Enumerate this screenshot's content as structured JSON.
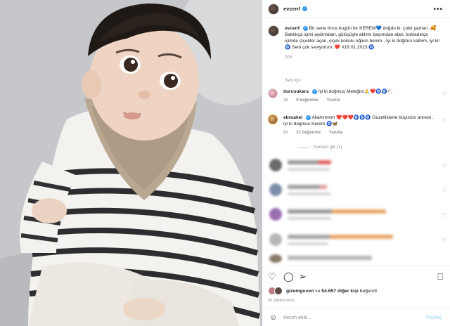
{
  "post": {
    "username": "evcenf",
    "caption_text": "Bir sene önce bugün bir KEREM💙 doğdu ki; çokk yaman..🥰 Baktıkça içimi aydınlatan, gülüşüyle aklımı başımdan alan, kokladıkça içimde çiçekler açan, çiçek kokulu oğlum benim.. İyi ki doğdun kalbim, iyi ki! 🧿 Seni çok seviyorum..❤️ #18.01.2023 🧿",
    "caption_age": "20d",
    "see_translation": "Seni için"
  },
  "comments": [
    {
      "username": "burcuukara",
      "text": "İyi ki doğmuş Meleğim🙏❤️🧿🧿🐑",
      "age": "3d",
      "likes": "6 beğenme",
      "reply": "Yanıtla"
    },
    {
      "username": "ebruakel",
      "text": "Allahımmm ❤️❤️❤️🧿🧿🧿 Guzelliklerle büyüsün annesi . iyi ki dogmus Kerem 🧿🦋",
      "age": "6d",
      "likes": "21 beğenme",
      "reply": "Yanıtla"
    }
  ],
  "view_replies": "Yanıtları gör (1)",
  "likes": {
    "user": "gizemguven",
    "middle": " ve ",
    "count": "54.657 diğer kişi",
    "suffix": " beğendi"
  },
  "time_ago": "20 dakika önce",
  "add_comment": {
    "placeholder": "Yorum ekle...",
    "post_label": "Paylaş"
  },
  "icons": {
    "more": "more-horizontal-icon",
    "heart": "heart-icon",
    "comment": "comment-icon",
    "share": "share-icon",
    "save": "bookmark-icon",
    "emoji": "emoji-icon"
  },
  "colors": {
    "verified": "#3897f0",
    "muted": "#8e8e8e",
    "post_button": "#b2dffc"
  }
}
